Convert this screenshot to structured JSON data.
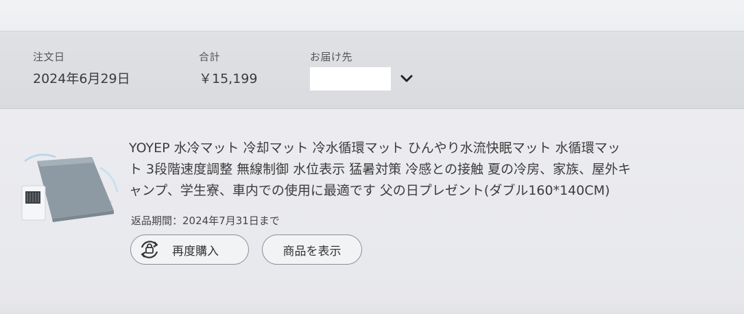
{
  "order_summary": {
    "date_label": "注文日",
    "date_value": "2024年6月29日",
    "total_label": "合計",
    "total_value": "￥15,199",
    "ship_label": "お届け先",
    "ship_icon": "chevron-down-icon"
  },
  "item": {
    "title_lines": [
      "YOYEP 水冷マット 冷却マット 冷水循環マット ひんやり水流快眠マット 水循環マッ",
      "ト 3段階速度調整 無線制御 水位表示 猛暑対策 冷感との接触 夏の冷房、家族、屋外キ",
      "ャンプ、学生寮、車内での使用に最適です 父の日プレゼント(ダブル160*140CM)"
    ],
    "return_period": "返品期間：2024年7月31日まで",
    "rebuy_label": "再度購入",
    "rebuy_icon": "rebuy-cycle-icon",
    "view_label": "商品を表示"
  },
  "colors": {
    "header_bg": "#dcdee2",
    "item_bg": "#eaebef",
    "button_border": "#8a8d92",
    "text": "#333333"
  }
}
